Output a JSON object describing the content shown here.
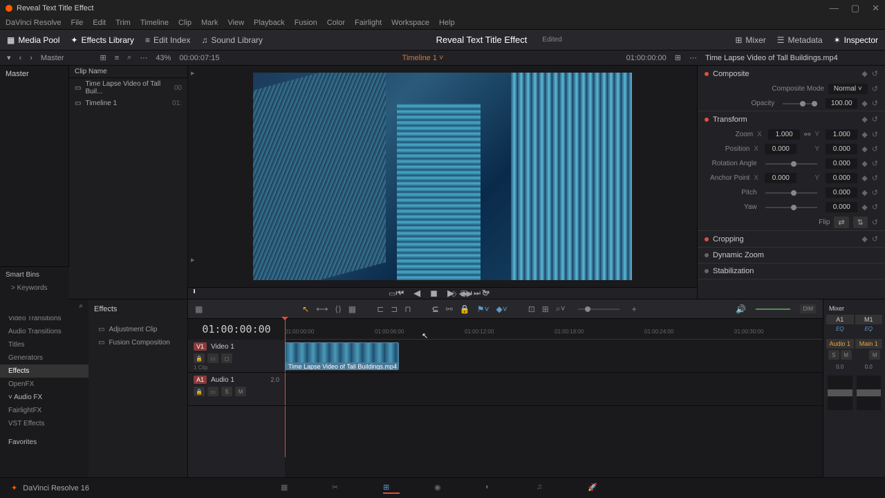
{
  "titlebar": {
    "title": "Reveal Text Title Effect"
  },
  "menubar": [
    "DaVinci Resolve",
    "File",
    "Edit",
    "Trim",
    "Timeline",
    "Clip",
    "Mark",
    "View",
    "Playback",
    "Fusion",
    "Color",
    "Fairlight",
    "Workspace",
    "Help"
  ],
  "toolbar": {
    "media_pool": "Media Pool",
    "effects_library": "Effects Library",
    "edit_index": "Edit Index",
    "sound_library": "Sound Library",
    "mixer": "Mixer",
    "metadata": "Metadata",
    "inspector": "Inspector"
  },
  "project": {
    "title": "Reveal Text Title Effect",
    "edited": "Edited"
  },
  "subbar": {
    "master": "Master",
    "zoom": "43%",
    "tc": "00:00:07:15",
    "timeline": "Timeline 1",
    "viewer_tc": "01:00:00:00",
    "clip_name": "Time Lapse Video of Tall Buildings.mp4"
  },
  "media": {
    "master": "Master",
    "clip_name_header": "Clip Name",
    "items": [
      {
        "name": "Time Lapse Video of Tall Buil...",
        "tc": "00"
      },
      {
        "name": "Timeline 1",
        "tc": "01:"
      }
    ]
  },
  "smart_bins": {
    "title": "Smart Bins",
    "keywords": "Keywords"
  },
  "inspector": {
    "clip": "Time Lapse Video of Tall Buildings.mp4",
    "composite": "Composite",
    "composite_mode_label": "Composite Mode",
    "composite_mode": "Normal",
    "opacity_label": "Opacity",
    "opacity": "100.00",
    "transform": "Transform",
    "zoom_label": "Zoom",
    "zoom_x": "1.000",
    "zoom_y": "1.000",
    "position_label": "Position",
    "pos_x": "0.000",
    "pos_y": "0.000",
    "rotation_label": "Rotation Angle",
    "rotation": "0.000",
    "anchor_label": "Anchor Point",
    "anchor_x": "0.000",
    "anchor_y": "0.000",
    "pitch_label": "Pitch",
    "pitch": "0.000",
    "yaw_label": "Yaw",
    "yaw": "0.000",
    "flip_label": "Flip",
    "cropping": "Cropping",
    "dynamic_zoom": "Dynamic Zoom",
    "stabilization": "Stabilization"
  },
  "effects": {
    "categories": [
      "Video Transitions",
      "Audio Transitions",
      "Titles",
      "Generators",
      "Effects",
      "OpenFX",
      "Audio FX",
      "FairlightFX",
      "VST Effects"
    ],
    "favorites": "Favorites",
    "title": "Effects",
    "items": [
      "Adjustment Clip",
      "Fusion Composition"
    ]
  },
  "timeline": {
    "tc": "01:00:00:00",
    "ticks": [
      "01:00:00:00",
      "01:00:06:00",
      "01:00:12:00",
      "01:00:18:00",
      "01:00:24:00",
      "01:00:30:00"
    ],
    "video_track": "Video 1",
    "video_badge": "V1",
    "video_clips": "1 Clip",
    "audio_track": "Audio 1",
    "audio_badge": "A1",
    "audio_ch": "2.0",
    "clip_name": "Time Lapse Video of Tall Buildings.mp4"
  },
  "mixer": {
    "title": "Mixer",
    "a1": "A1",
    "m1": "M1",
    "eq": "EQ",
    "audio1": "Audio 1",
    "main1": "Main 1",
    "s": "S",
    "m": "M",
    "db": "0.0"
  },
  "bottombar": {
    "name": "DaVinci Resolve 16"
  }
}
